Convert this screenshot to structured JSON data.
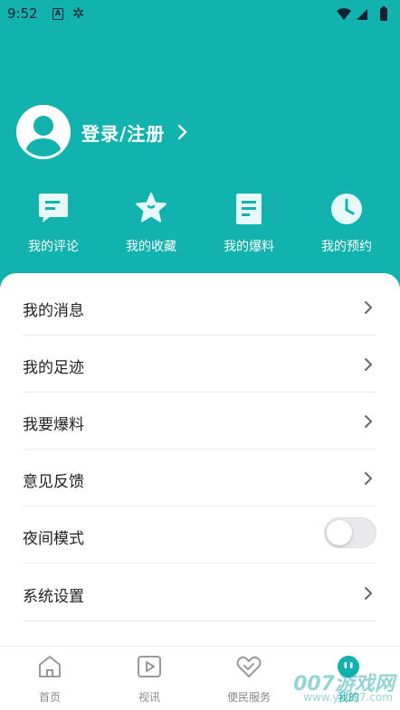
{
  "status_bar": {
    "time": "9:52",
    "icons": [
      "notification-a-icon",
      "bug-icon",
      "wifi-icon",
      "signal-icon",
      "battery-icon"
    ]
  },
  "profile": {
    "login_label": "登录/注册"
  },
  "shortcuts": [
    {
      "label": "我的评论",
      "icon": "comment-icon"
    },
    {
      "label": "我的收藏",
      "icon": "star-icon"
    },
    {
      "label": "我的爆料",
      "icon": "document-icon"
    },
    {
      "label": "我的预约",
      "icon": "clock-icon"
    }
  ],
  "menu": [
    {
      "label": "我的消息",
      "type": "link"
    },
    {
      "label": "我的足迹",
      "type": "link"
    },
    {
      "label": "我要爆料",
      "type": "link"
    },
    {
      "label": "意见反馈",
      "type": "link"
    },
    {
      "label": "夜间模式",
      "type": "toggle",
      "on": false
    },
    {
      "label": "系统设置",
      "type": "link"
    }
  ],
  "bottom_nav": [
    {
      "label": "首页",
      "icon": "home-icon",
      "active": false
    },
    {
      "label": "视讯",
      "icon": "video-icon",
      "active": false
    },
    {
      "label": "便民服务",
      "icon": "heart-service-icon",
      "active": false
    },
    {
      "label": "我的",
      "icon": "me-face-icon",
      "active": true
    }
  ],
  "watermark": {
    "text": "007游戏网",
    "sub": "www.yx007.com"
  },
  "colors": {
    "brand": "#12b3ae",
    "text": "#222222",
    "muted": "#888888"
  }
}
